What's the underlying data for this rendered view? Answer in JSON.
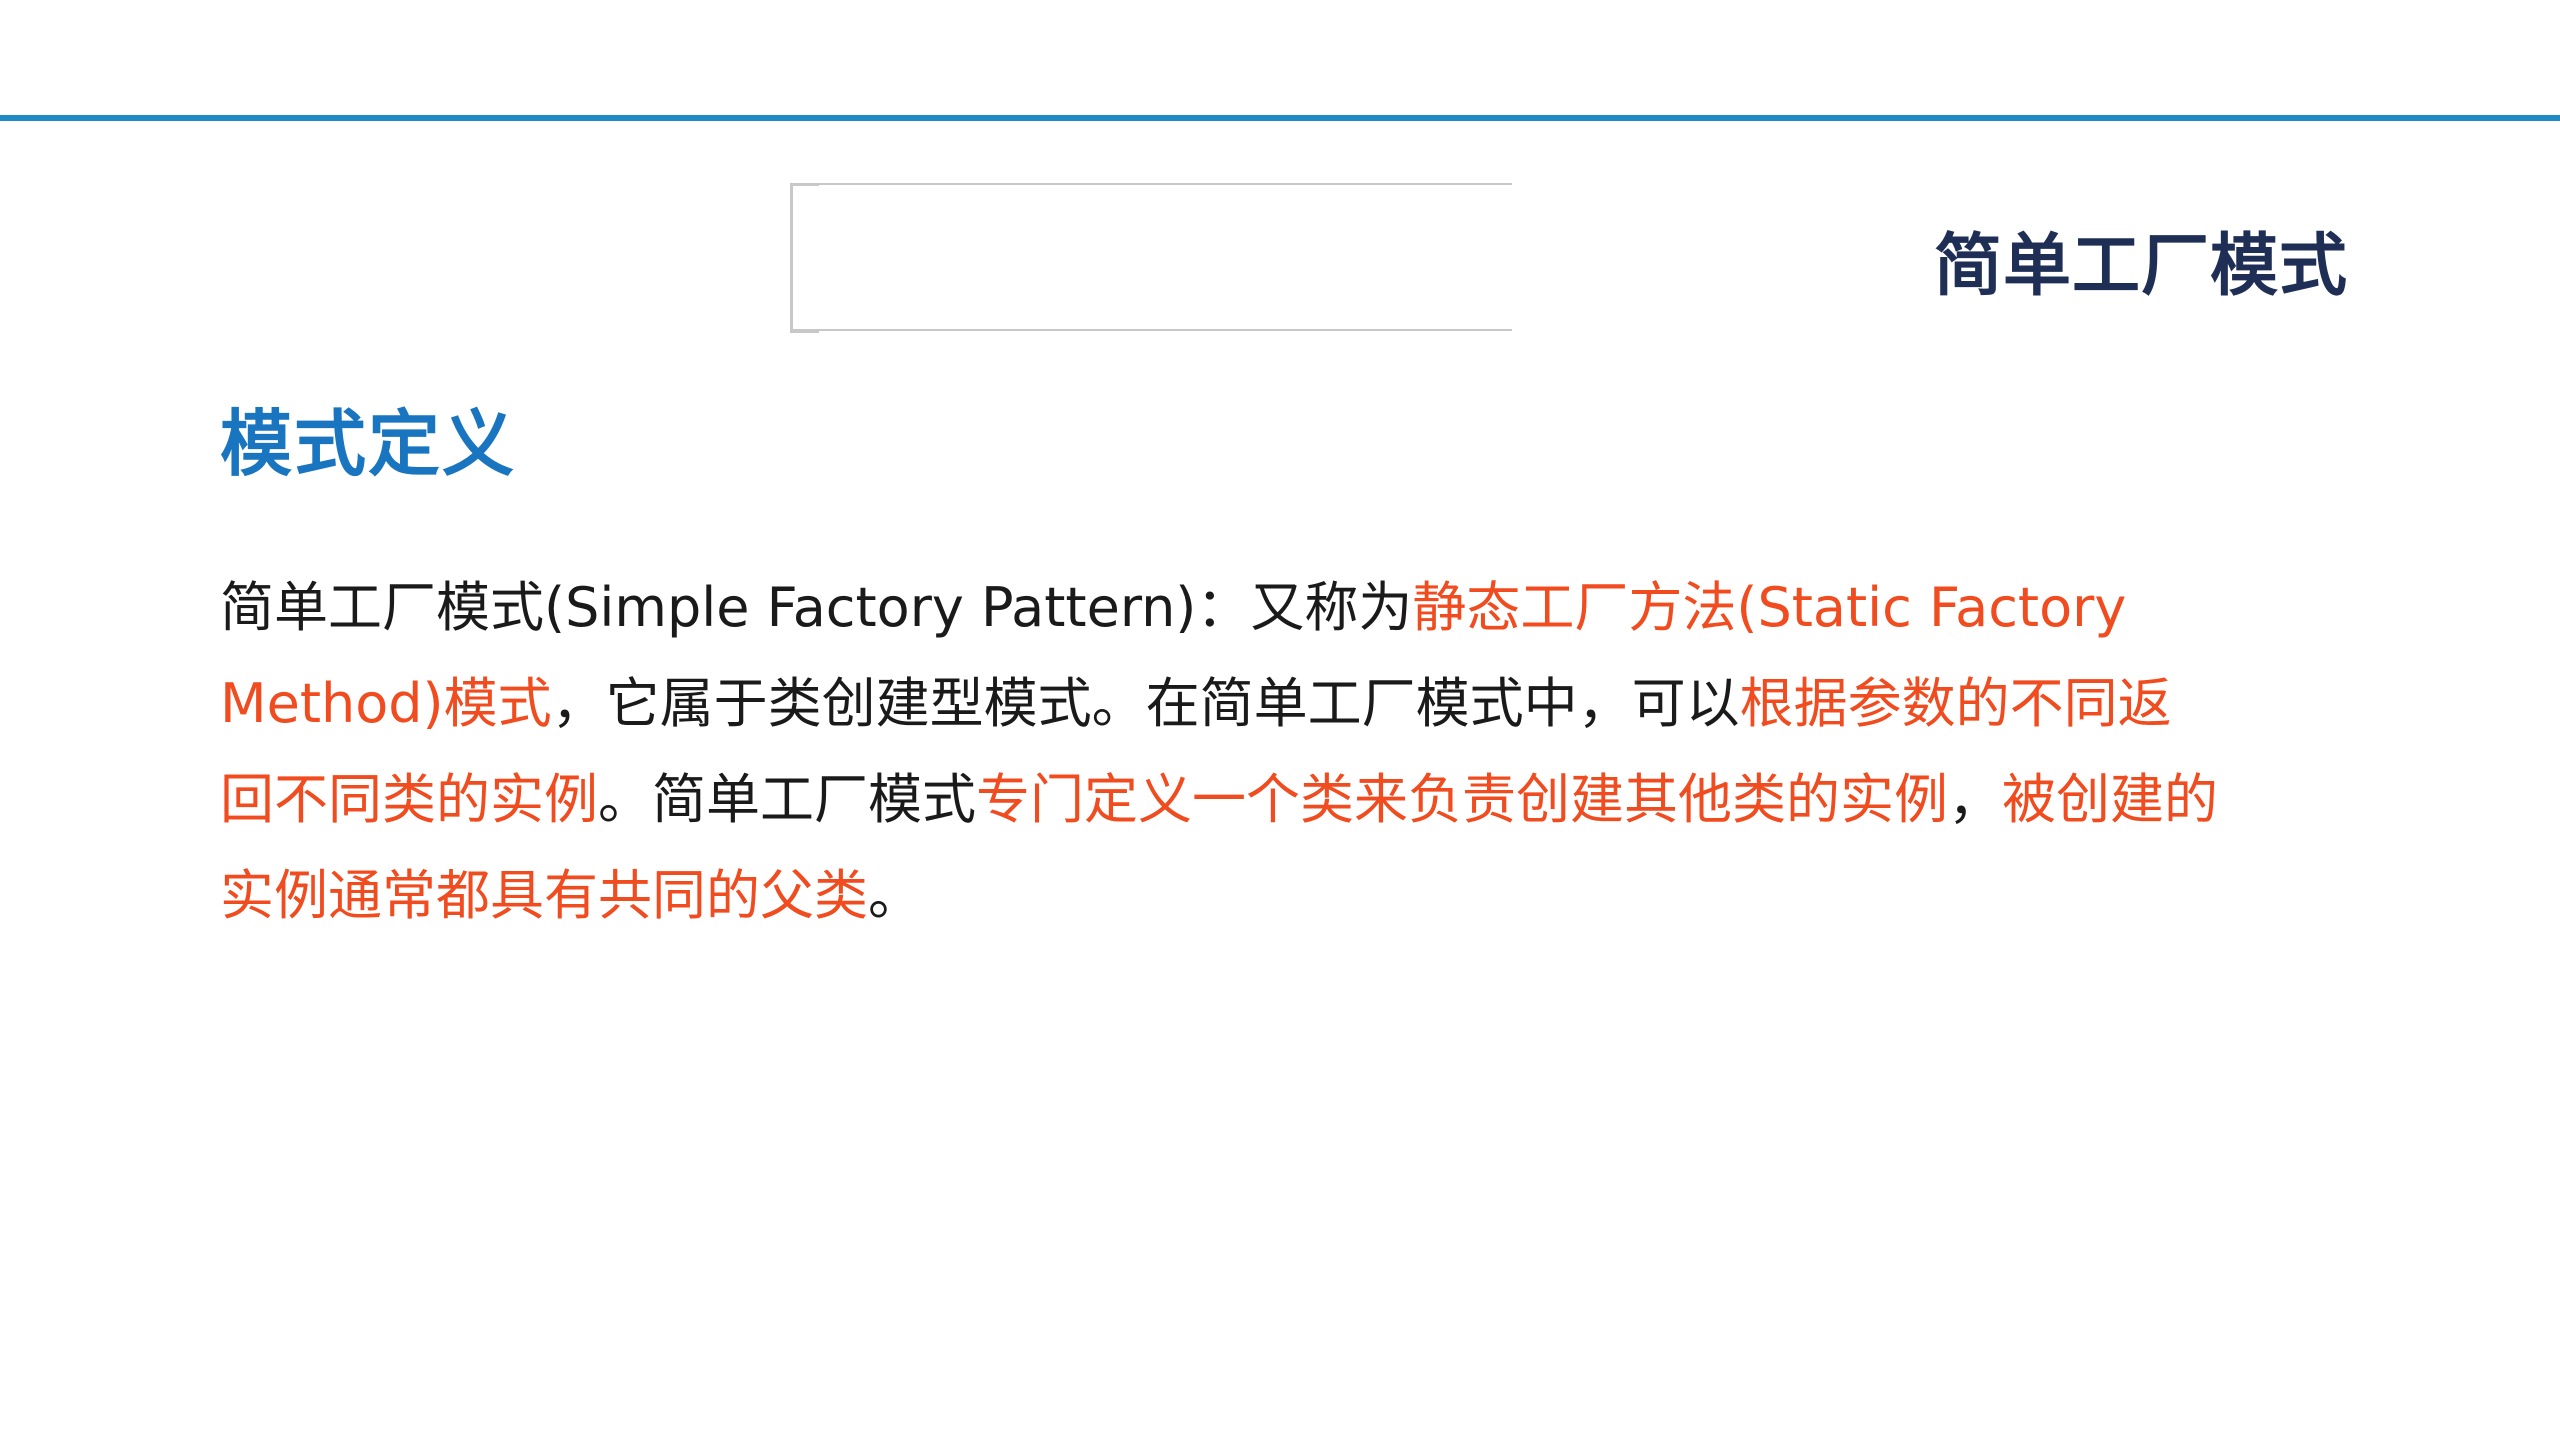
{
  "page_title": "简单工厂模式",
  "section_heading": "模式定义",
  "definition": {
    "segments": [
      {
        "text": "简单工厂模式(Simple Factory Pattern)：又称为",
        "highlight": false
      },
      {
        "text": "静态工厂方法(Static Factory Method)模式",
        "highlight": true
      },
      {
        "text": "，它属于类创建型模式。在简单工厂模式中，可以",
        "highlight": false
      },
      {
        "text": "根据参数的不同返回不同类的实例",
        "highlight": true
      },
      {
        "text": "。简单工厂模式",
        "highlight": false
      },
      {
        "text": "专门定义一个类来负责创建其他类的实例",
        "highlight": true
      },
      {
        "text": "，",
        "highlight": false
      },
      {
        "text": "被创建的实例通常都具有共同的父类",
        "highlight": true
      },
      {
        "text": "。",
        "highlight": false
      }
    ]
  },
  "colors": {
    "accent_rule": "#1f8ac4",
    "title": "#1f2e55",
    "heading": "#1a75c0",
    "body_text": "#1a1a1a",
    "highlight_text": "#f04c1f"
  }
}
